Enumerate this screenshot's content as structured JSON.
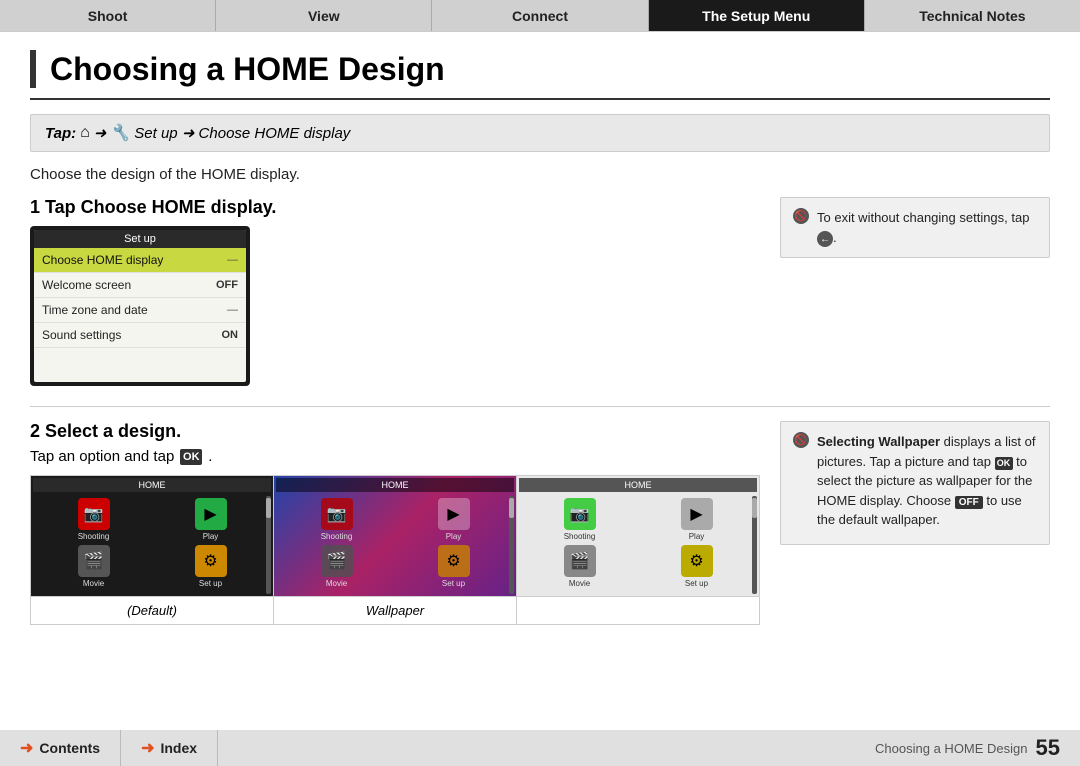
{
  "nav": {
    "items": [
      {
        "label": "Shoot",
        "active": false
      },
      {
        "label": "View",
        "active": false
      },
      {
        "label": "Connect",
        "active": false
      },
      {
        "label": "The Setup Menu",
        "active": true
      },
      {
        "label": "Technical Notes",
        "active": false
      }
    ]
  },
  "page": {
    "title": "Choosing a HOME Design",
    "tap_instruction": "Tap:  ➜  Set up ➜ Choose HOME display",
    "description": "Choose the design of the HOME display.",
    "step1": {
      "heading": "1 Tap Choose HOME display.",
      "note": "To exit without changing settings, tap .",
      "menu": {
        "title": "Set up",
        "items": [
          {
            "label": "Choose HOME display",
            "value": "—",
            "selected": true
          },
          {
            "label": "Welcome screen",
            "value": "OFF"
          },
          {
            "label": "Time zone and date",
            "value": "—"
          },
          {
            "label": "Sound settings",
            "value": "ON"
          }
        ]
      }
    },
    "step2": {
      "heading": "2 Select a design.",
      "sub": "Tap an option and tap",
      "ok_label": "OK",
      "screens": [
        {
          "label": "(Default)"
        },
        {
          "label": "Wallpaper"
        },
        {
          "label": ""
        }
      ],
      "note_bold": "Selecting Wallpaper",
      "note_text": " displays a list of pictures. Tap a picture and tap  to select the picture as wallpaper for the HOME display. Choose  to use the default wallpaper."
    },
    "footer": {
      "contents_label": "Contents",
      "index_label": "Index",
      "page_desc": "Choosing a HOME Design",
      "page_num": "55"
    }
  }
}
